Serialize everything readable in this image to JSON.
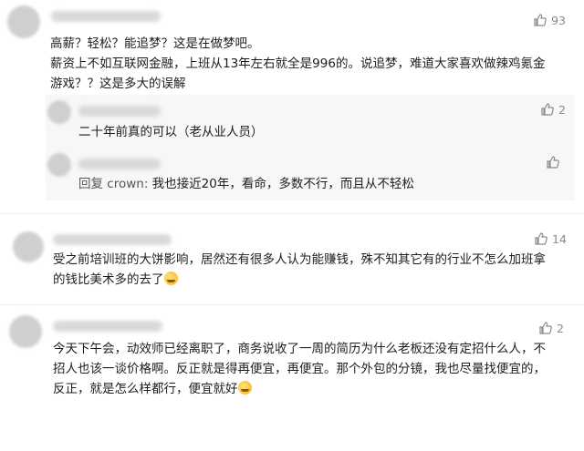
{
  "comments": [
    {
      "likes": "93",
      "lines": [
        "高薪？轻松？能追梦？这是在做梦吧。",
        "薪资上不如互联网金融，上班从13年左右就全是996的。说追梦，难道大家喜欢做辣鸡氪金",
        "游戏？？这是多大的误解"
      ],
      "replies": [
        {
          "likes": "2",
          "text": "二十年前真的可以（老从业人员）"
        },
        {
          "likes": "",
          "prefix": "回复 crown:",
          "text": " 我也接近20年，看命，多数不行，而且从不轻松"
        }
      ]
    },
    {
      "likes": "14",
      "lines": [
        "受之前培训班的大饼影响，居然还有很多人认为能赚钱，殊不知其它有的行业不怎么加班拿",
        "的钱比美术多的去了"
      ]
    },
    {
      "likes": "2",
      "lines": [
        "今天下午会，动效师已经离职了，商务说收了一周的简历为什么老板还没有定招什么人，不",
        "招人也该一谈价格啊。反正就是得再便宜，再便宜。那个外包的分镜，我也尽量找便宜的，",
        "反正，就是怎么样都行，便宜就好"
      ]
    }
  ],
  "icons": {
    "like": "thumbs-up-icon",
    "emoji": "laughing-emoji-icon"
  }
}
